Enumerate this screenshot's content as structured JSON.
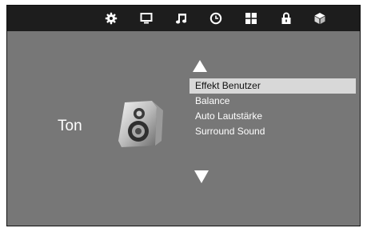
{
  "topbar": {
    "icons": [
      "gear-icon",
      "monitor-icon",
      "music-icon",
      "clock-icon",
      "grid-icon",
      "lock-icon",
      "cube-icon"
    ]
  },
  "section": {
    "title": "Ton",
    "icon": "speaker-icon"
  },
  "menu": {
    "selected_index": 0,
    "items": [
      {
        "label": "Effekt Benutzer"
      },
      {
        "label": "Balance"
      },
      {
        "label": "Auto Lautstärke"
      },
      {
        "label": "Surround Sound"
      }
    ]
  },
  "colors": {
    "background": "#777777",
    "topbar": "#1d1d1d",
    "highlight": "#d8d8d8",
    "text": "#ffffff"
  }
}
